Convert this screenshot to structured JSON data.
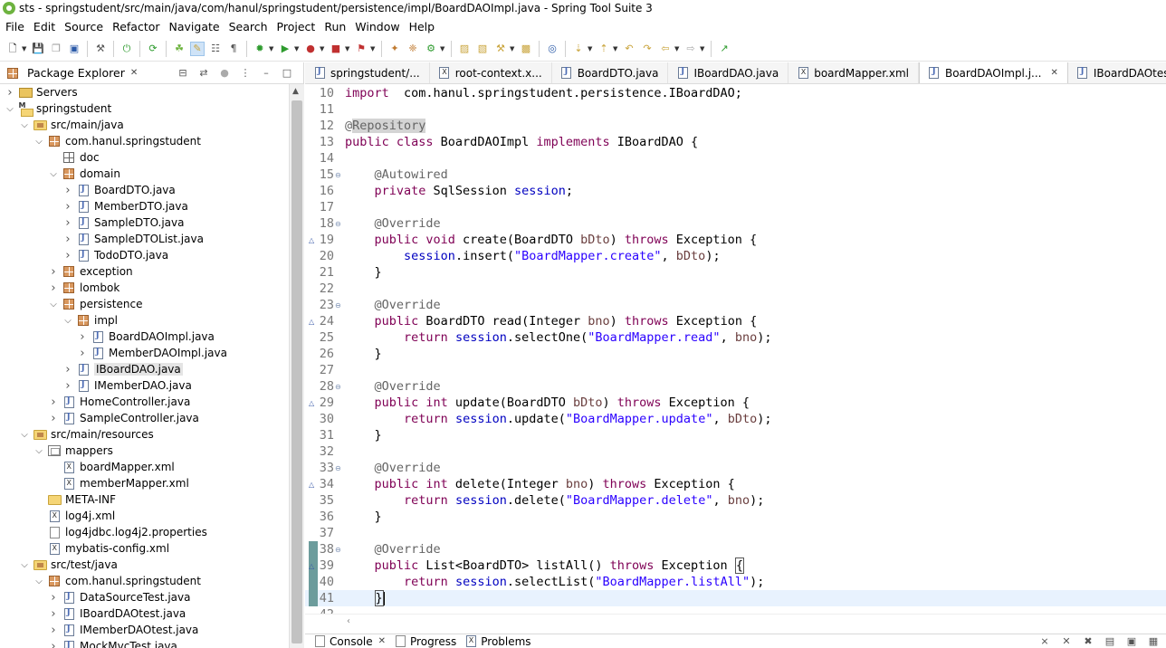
{
  "window": {
    "title": "sts - springstudent/src/main/java/com/hanul/springstudent/persistence/impl/BoardDAOImpl.java - Spring Tool Suite 3"
  },
  "menubar": {
    "items": [
      "File",
      "Edit",
      "Source",
      "Refactor",
      "Navigate",
      "Search",
      "Project",
      "Run",
      "Window",
      "Help"
    ]
  },
  "package_explorer": {
    "title": "Package Explorer",
    "tree": [
      {
        "depth": 0,
        "twisty": "collapsed",
        "icon": "servers-folder-icon",
        "label": "Servers"
      },
      {
        "depth": 0,
        "twisty": "expanded",
        "icon": "maven-project-icon",
        "label": "springstudent"
      },
      {
        "depth": 1,
        "twisty": "expanded",
        "icon": "source-folder-icon",
        "label": "src/main/java"
      },
      {
        "depth": 2,
        "twisty": "expanded",
        "icon": "package-icon",
        "label": "com.hanul.springstudent"
      },
      {
        "depth": 3,
        "twisty": "none",
        "icon": "empty-package-icon",
        "label": "doc"
      },
      {
        "depth": 3,
        "twisty": "expanded",
        "icon": "package-icon",
        "label": "domain"
      },
      {
        "depth": 4,
        "twisty": "collapsed",
        "icon": "java-file-icon",
        "label": "BoardDTO.java"
      },
      {
        "depth": 4,
        "twisty": "collapsed",
        "icon": "java-file-icon",
        "label": "MemberDTO.java"
      },
      {
        "depth": 4,
        "twisty": "collapsed",
        "icon": "java-file-icon",
        "label": "SampleDTO.java"
      },
      {
        "depth": 4,
        "twisty": "collapsed",
        "icon": "java-file-icon",
        "label": "SampleDTOList.java"
      },
      {
        "depth": 4,
        "twisty": "collapsed",
        "icon": "java-file-icon",
        "label": "TodoDTO.java"
      },
      {
        "depth": 3,
        "twisty": "collapsed",
        "icon": "package-icon",
        "label": "exception"
      },
      {
        "depth": 3,
        "twisty": "collapsed",
        "icon": "package-icon",
        "label": "lombok"
      },
      {
        "depth": 3,
        "twisty": "expanded",
        "icon": "package-icon",
        "label": "persistence"
      },
      {
        "depth": 4,
        "twisty": "expanded",
        "icon": "package-icon",
        "label": "impl"
      },
      {
        "depth": 5,
        "twisty": "collapsed",
        "icon": "java-file-icon",
        "label": "BoardDAOImpl.java"
      },
      {
        "depth": 5,
        "twisty": "collapsed",
        "icon": "java-file-icon",
        "label": "MemberDAOImpl.java"
      },
      {
        "depth": 4,
        "twisty": "collapsed",
        "icon": "java-file-icon",
        "label": "IBoardDAO.java",
        "selected": true
      },
      {
        "depth": 4,
        "twisty": "collapsed",
        "icon": "java-file-icon",
        "label": "IMemberDAO.java"
      },
      {
        "depth": 3,
        "twisty": "collapsed",
        "icon": "java-file-icon",
        "label": "HomeController.java"
      },
      {
        "depth": 3,
        "twisty": "collapsed",
        "icon": "java-file-icon",
        "label": "SampleController.java"
      },
      {
        "depth": 1,
        "twisty": "expanded",
        "icon": "source-folder-icon",
        "label": "src/main/resources"
      },
      {
        "depth": 2,
        "twisty": "expanded",
        "icon": "mappers-package-icon",
        "label": "mappers"
      },
      {
        "depth": 3,
        "twisty": "none",
        "icon": "xml-file-icon",
        "label": "boardMapper.xml"
      },
      {
        "depth": 3,
        "twisty": "none",
        "icon": "xml-file-icon",
        "label": "memberMapper.xml"
      },
      {
        "depth": 2,
        "twisty": "none",
        "icon": "folder-icon",
        "label": "META-INF"
      },
      {
        "depth": 2,
        "twisty": "none",
        "icon": "xml-file-icon",
        "label": "log4j.xml"
      },
      {
        "depth": 2,
        "twisty": "none",
        "icon": "text-file-icon",
        "label": "log4jdbc.log4j2.properties"
      },
      {
        "depth": 2,
        "twisty": "none",
        "icon": "xml-file-icon",
        "label": "mybatis-config.xml"
      },
      {
        "depth": 1,
        "twisty": "expanded",
        "icon": "source-folder-icon",
        "label": "src/test/java"
      },
      {
        "depth": 2,
        "twisty": "expanded",
        "icon": "package-icon",
        "label": "com.hanul.springstudent"
      },
      {
        "depth": 3,
        "twisty": "collapsed",
        "icon": "java-file-icon",
        "label": "DataSourceTest.java"
      },
      {
        "depth": 3,
        "twisty": "collapsed",
        "icon": "java-file-icon",
        "label": "IBoardDAOtest.java"
      },
      {
        "depth": 3,
        "twisty": "collapsed",
        "icon": "java-file-icon",
        "label": "IMemberDAOtest.java"
      },
      {
        "depth": 3,
        "twisty": "collapsed",
        "icon": "java-file-icon",
        "label": "MockMvcTest.java"
      }
    ]
  },
  "editor": {
    "tabs": [
      {
        "label": "springstudent/...",
        "icon": "java-file-icon"
      },
      {
        "label": "root-context.x...",
        "icon": "xml-file-icon"
      },
      {
        "label": "BoardDTO.java",
        "icon": "java-file-icon"
      },
      {
        "label": "IBoardDAO.java",
        "icon": "java-file-icon"
      },
      {
        "label": "boardMapper.xml",
        "icon": "xml-file-icon"
      },
      {
        "label": "BoardDAOImpl.j...",
        "icon": "java-file-icon",
        "active": true
      },
      {
        "label": "IBoardDAOtest...",
        "icon": "java-file-icon"
      }
    ],
    "lines": [
      {
        "n": "10",
        "segs": [
          [
            "kw",
            "import"
          ],
          [
            "",
            "  com.hanul.springstudent.persistence.IBoardDAO;"
          ]
        ]
      },
      {
        "n": "11",
        "segs": []
      },
      {
        "n": "12",
        "segs": [
          [
            "ann",
            "@"
          ],
          [
            "ann ann-hl",
            "Repository"
          ]
        ]
      },
      {
        "n": "13",
        "segs": [
          [
            "kw",
            "public class"
          ],
          [
            "",
            " BoardDAOImpl "
          ],
          [
            "kw",
            "implements"
          ],
          [
            "",
            " IBoardDAO {"
          ]
        ]
      },
      {
        "n": "14",
        "segs": []
      },
      {
        "n": "15",
        "fold": true,
        "segs": [
          [
            "",
            "    "
          ],
          [
            "ann",
            "@Autowired"
          ]
        ]
      },
      {
        "n": "16",
        "segs": [
          [
            "",
            "    "
          ],
          [
            "kw",
            "private"
          ],
          [
            "",
            " SqlSession "
          ],
          [
            "fld",
            "session"
          ],
          [
            "",
            ";"
          ]
        ]
      },
      {
        "n": "17",
        "segs": []
      },
      {
        "n": "18",
        "fold": true,
        "segs": [
          [
            "",
            "    "
          ],
          [
            "ann",
            "@Override"
          ]
        ]
      },
      {
        "n": "19",
        "override": true,
        "segs": [
          [
            "",
            "    "
          ],
          [
            "kw",
            "public void"
          ],
          [
            "",
            " create(BoardDTO "
          ],
          [
            "param",
            "bDto"
          ],
          [
            "",
            ") "
          ],
          [
            "kw",
            "throws"
          ],
          [
            "",
            " Exception {"
          ]
        ]
      },
      {
        "n": "20",
        "segs": [
          [
            "",
            "        "
          ],
          [
            "fld",
            "session"
          ],
          [
            "",
            ".insert("
          ],
          [
            "str",
            "\"BoardMapper.create\""
          ],
          [
            "",
            ", "
          ],
          [
            "param",
            "bDto"
          ],
          [
            "",
            ");"
          ]
        ]
      },
      {
        "n": "21",
        "segs": [
          [
            "",
            "    }"
          ]
        ]
      },
      {
        "n": "22",
        "segs": []
      },
      {
        "n": "23",
        "fold": true,
        "segs": [
          [
            "",
            "    "
          ],
          [
            "ann",
            "@Override"
          ]
        ]
      },
      {
        "n": "24",
        "override": true,
        "segs": [
          [
            "",
            "    "
          ],
          [
            "kw",
            "public"
          ],
          [
            "",
            " BoardDTO read(Integer "
          ],
          [
            "param",
            "bno"
          ],
          [
            "",
            ") "
          ],
          [
            "kw",
            "throws"
          ],
          [
            "",
            " Exception {"
          ]
        ]
      },
      {
        "n": "25",
        "segs": [
          [
            "",
            "        "
          ],
          [
            "kw",
            "return"
          ],
          [
            "",
            " "
          ],
          [
            "fld",
            "session"
          ],
          [
            "",
            ".selectOne("
          ],
          [
            "str",
            "\"BoardMapper.read\""
          ],
          [
            "",
            ", "
          ],
          [
            "param",
            "bno"
          ],
          [
            "",
            ");"
          ]
        ]
      },
      {
        "n": "26",
        "segs": [
          [
            "",
            "    }"
          ]
        ]
      },
      {
        "n": "27",
        "segs": []
      },
      {
        "n": "28",
        "fold": true,
        "segs": [
          [
            "",
            "    "
          ],
          [
            "ann",
            "@Override"
          ]
        ]
      },
      {
        "n": "29",
        "override": true,
        "segs": [
          [
            "",
            "    "
          ],
          [
            "kw",
            "public int"
          ],
          [
            "",
            " update(BoardDTO "
          ],
          [
            "param",
            "bDto"
          ],
          [
            "",
            ") "
          ],
          [
            "kw",
            "throws"
          ],
          [
            "",
            " Exception {"
          ]
        ]
      },
      {
        "n": "30",
        "segs": [
          [
            "",
            "        "
          ],
          [
            "kw",
            "return"
          ],
          [
            "",
            " "
          ],
          [
            "fld",
            "session"
          ],
          [
            "",
            ".update("
          ],
          [
            "str",
            "\"BoardMapper.update\""
          ],
          [
            "",
            ", "
          ],
          [
            "param",
            "bDto"
          ],
          [
            "",
            ");"
          ]
        ]
      },
      {
        "n": "31",
        "segs": [
          [
            "",
            "    }"
          ]
        ]
      },
      {
        "n": "32",
        "segs": []
      },
      {
        "n": "33",
        "fold": true,
        "segs": [
          [
            "",
            "    "
          ],
          [
            "ann",
            "@Override"
          ]
        ]
      },
      {
        "n": "34",
        "override": true,
        "segs": [
          [
            "",
            "    "
          ],
          [
            "kw",
            "public int"
          ],
          [
            "",
            " delete(Integer "
          ],
          [
            "param",
            "bno"
          ],
          [
            "",
            ") "
          ],
          [
            "kw",
            "throws"
          ],
          [
            "",
            " Exception {"
          ]
        ]
      },
      {
        "n": "35",
        "segs": [
          [
            "",
            "        "
          ],
          [
            "kw",
            "return"
          ],
          [
            "",
            " "
          ],
          [
            "fld",
            "session"
          ],
          [
            "",
            ".delete("
          ],
          [
            "str",
            "\"BoardMapper.delete\""
          ],
          [
            "",
            ", "
          ],
          [
            "param",
            "bno"
          ],
          [
            "",
            ");"
          ]
        ]
      },
      {
        "n": "36",
        "segs": [
          [
            "",
            "    }"
          ]
        ]
      },
      {
        "n": "37",
        "segs": []
      },
      {
        "n": "38",
        "fold": true,
        "mark": true,
        "segs": [
          [
            "",
            "    "
          ],
          [
            "ann",
            "@Override"
          ]
        ]
      },
      {
        "n": "39",
        "override": true,
        "mark": true,
        "segs": [
          [
            "",
            "    "
          ],
          [
            "kw",
            "public"
          ],
          [
            "",
            " List<BoardDTO> listAll() "
          ],
          [
            "kw",
            "throws"
          ],
          [
            "",
            " Exception "
          ],
          [
            "bracket-box",
            "{"
          ]
        ]
      },
      {
        "n": "40",
        "mark": true,
        "segs": [
          [
            "",
            "        "
          ],
          [
            "kw",
            "return"
          ],
          [
            "",
            " "
          ],
          [
            "fld",
            "session"
          ],
          [
            "",
            ".selectList("
          ],
          [
            "str",
            "\"BoardMapper.listAll\""
          ],
          [
            "",
            ");"
          ]
        ]
      },
      {
        "n": "41",
        "mark": true,
        "current": true,
        "segs": [
          [
            "",
            "    "
          ],
          [
            "bracket-box",
            "}"
          ]
        ]
      },
      {
        "n": "42",
        "segs": []
      }
    ]
  },
  "bottom_panel": {
    "tabs": [
      {
        "label": "Console",
        "icon": "console-icon"
      },
      {
        "label": "Progress",
        "icon": "progress-icon"
      },
      {
        "label": "Problems",
        "icon": "problems-icon"
      }
    ]
  }
}
